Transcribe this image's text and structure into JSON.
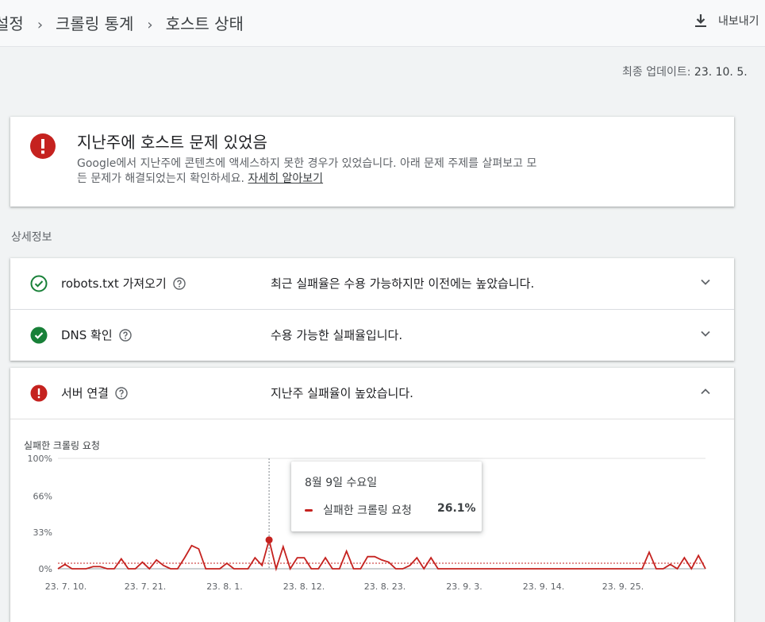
{
  "breadcrumb": {
    "items": [
      "설정",
      "크롤링 통계",
      "호스트 상태"
    ],
    "separator": "›"
  },
  "export_label": "내보내기",
  "updated": {
    "label": "최종 업데이트:",
    "value": "23. 10. 5."
  },
  "alert": {
    "title": "지난주에 호스트 문제 있었음",
    "body": "Google에서 지난주에 콘텐츠에 액세스하지 못한 경우가 있었습니다. 아래 문제 주제를 살펴보고 모든 문제가 해결되었는지 확인하세요.",
    "link": "자세히 알아보기",
    "color": "#c5221f"
  },
  "section_label": "상세정보",
  "rows": [
    {
      "name": "robots.txt 가져오기",
      "status": "최근 실패율은 수용 가능하지만 이전에는 높았습니다.",
      "icon": "check-outline-icon",
      "expanded": false
    },
    {
      "name": "DNS 확인",
      "status": "수용 가능한 실패율입니다.",
      "icon": "check-filled-icon",
      "expanded": false
    },
    {
      "name": "서버 연결",
      "status": "지난주 실패율이 높았습니다.",
      "icon": "error-icon",
      "expanded": true
    }
  ],
  "colors": {
    "ok": "#188038",
    "error": "#c5221f"
  },
  "chart_data": {
    "type": "line",
    "title": "실패한 크롤링 요청",
    "ylim": [
      0,
      100
    ],
    "yticks": [
      "100%",
      "66%",
      "33%",
      "0%"
    ],
    "xticks": [
      "23. 7. 10.",
      "23. 7. 21.",
      "23. 8. 1.",
      "23. 8. 12.",
      "23. 8. 23.",
      "23. 9. 3.",
      "23. 9. 14.",
      "23. 9. 25."
    ],
    "x_range": [
      "2023-07-07",
      "2023-10-05"
    ],
    "reference_line": 5,
    "series": [
      {
        "name": "실패한 크롤링 요청",
        "values": [
          0,
          4,
          0,
          0,
          0,
          2,
          2,
          0,
          0,
          9,
          0,
          0,
          6,
          0,
          8,
          3,
          0,
          0,
          10,
          21,
          18,
          0,
          0,
          0,
          5,
          0,
          0,
          0,
          10,
          3,
          26.1,
          0,
          20,
          0,
          10,
          10,
          0,
          0,
          10,
          0,
          0,
          16,
          0,
          0,
          11,
          11,
          8,
          6,
          0,
          0,
          3,
          10,
          0,
          10,
          0,
          0,
          0,
          0,
          0,
          0,
          0,
          0,
          0,
          0,
          0,
          0,
          0,
          0,
          0,
          0,
          0,
          0,
          0,
          0,
          0,
          0,
          0,
          0,
          0,
          0,
          0,
          0,
          0,
          0,
          15,
          0,
          0,
          4,
          0,
          10,
          0,
          12,
          0
        ],
        "color": "#c5221f"
      }
    ],
    "tooltip": {
      "date": "8월 9일 수요일",
      "series": "실패한 크롤링 요청",
      "value": "26.1%"
    }
  }
}
